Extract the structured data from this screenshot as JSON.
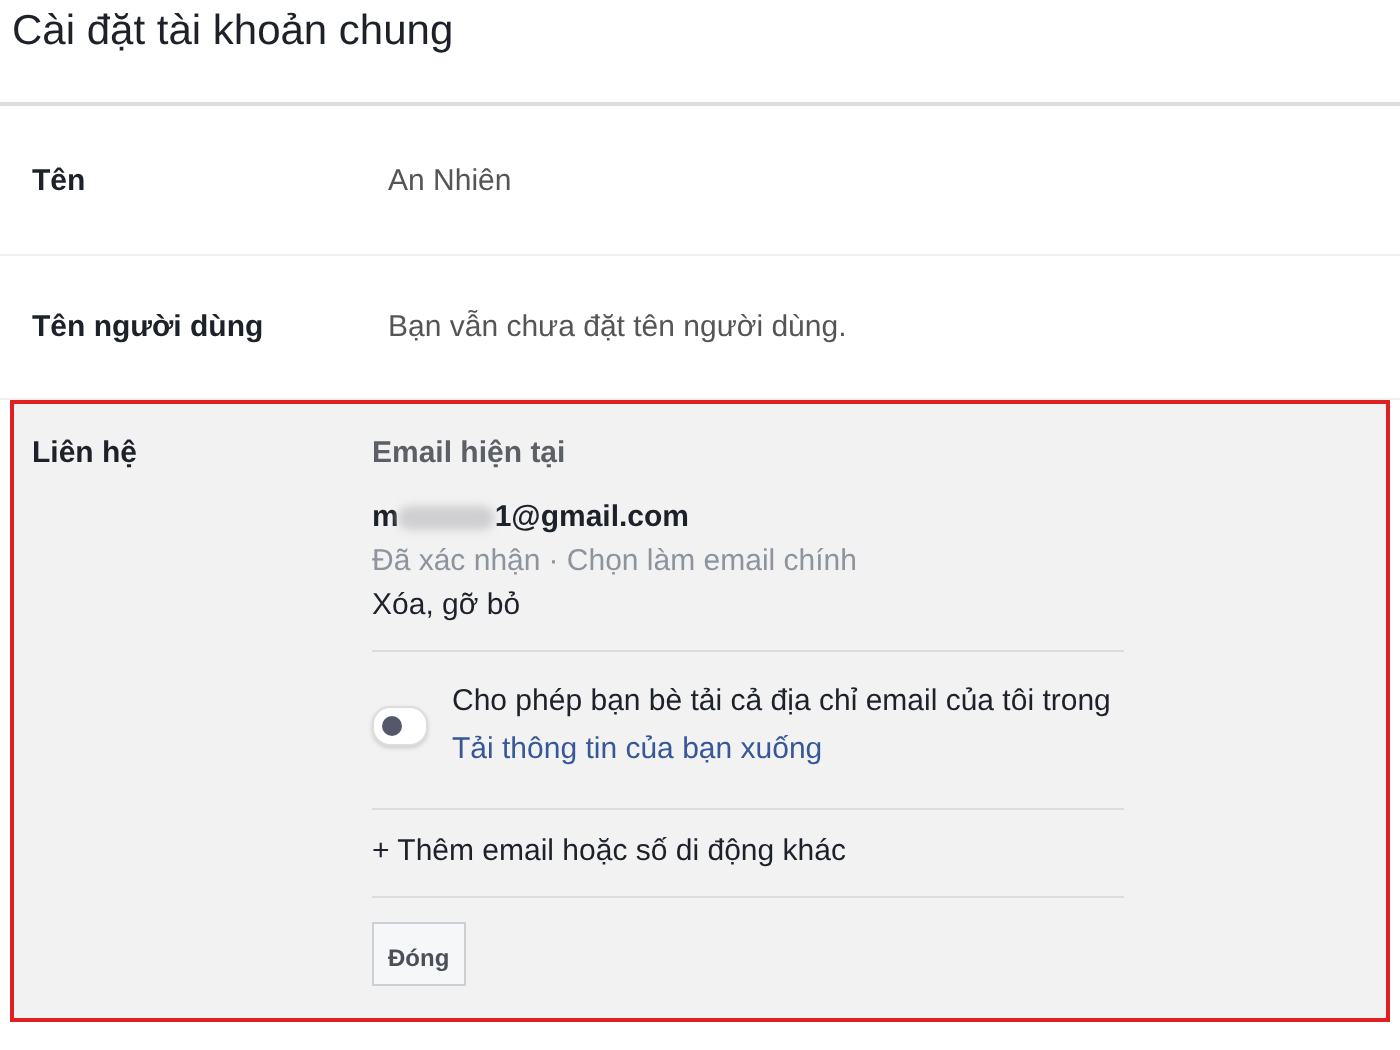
{
  "title": "Cài đặt tài khoản chung",
  "rows": [
    {
      "label": "Tên",
      "value": "An Nhiên"
    },
    {
      "label": "Tên người dùng",
      "value": "Bạn vẫn chưa đặt tên người dùng."
    }
  ],
  "contact": {
    "label": "Liên hệ",
    "heading": "Email hiện tại",
    "email_start": "m",
    "email_end": "1@gmail.com",
    "status": "Đã xác nhận",
    "make_primary": "· Chọn làm email chính",
    "remove": "Xóa, gỡ bỏ",
    "toggle": {
      "on": false,
      "text": "Cho phép bạn bè tải cả địa chỉ email của tôi trong ",
      "link": "Tải thông tin của bạn xuống"
    },
    "add": "+ Thêm email hoặc số di động khác",
    "close_button": "Đóng"
  }
}
